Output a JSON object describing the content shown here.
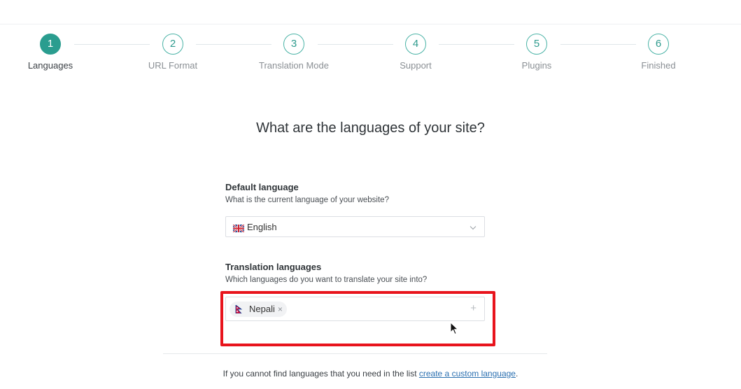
{
  "steps": [
    {
      "number": "1",
      "label": "Languages",
      "active": true
    },
    {
      "number": "2",
      "label": "URL Format",
      "active": false
    },
    {
      "number": "3",
      "label": "Translation Mode",
      "active": false
    },
    {
      "number": "4",
      "label": "Support",
      "active": false
    },
    {
      "number": "5",
      "label": "Plugins",
      "active": false
    },
    {
      "number": "6",
      "label": "Finished",
      "active": false
    }
  ],
  "main": {
    "title": "What are the languages of your site?"
  },
  "default_language": {
    "title": "Default language",
    "subtitle": "What is the current language of your website?",
    "selected": "English",
    "flag_icon": "uk-flag-icon"
  },
  "translation_languages": {
    "title": "Translation languages",
    "subtitle": "Which languages do you want to translate your site into?",
    "tags": [
      {
        "label": "Nepali",
        "flag_icon": "nepal-flag-icon",
        "remove": "×"
      }
    ],
    "add_symbol": "+"
  },
  "footer": {
    "text": "If you cannot find languages that you need in the list ",
    "link_text": "create a custom language",
    "end": "."
  },
  "colors": {
    "accent": "#2a9d8f",
    "highlight": "#e8141c",
    "link": "#2a6fb0"
  }
}
